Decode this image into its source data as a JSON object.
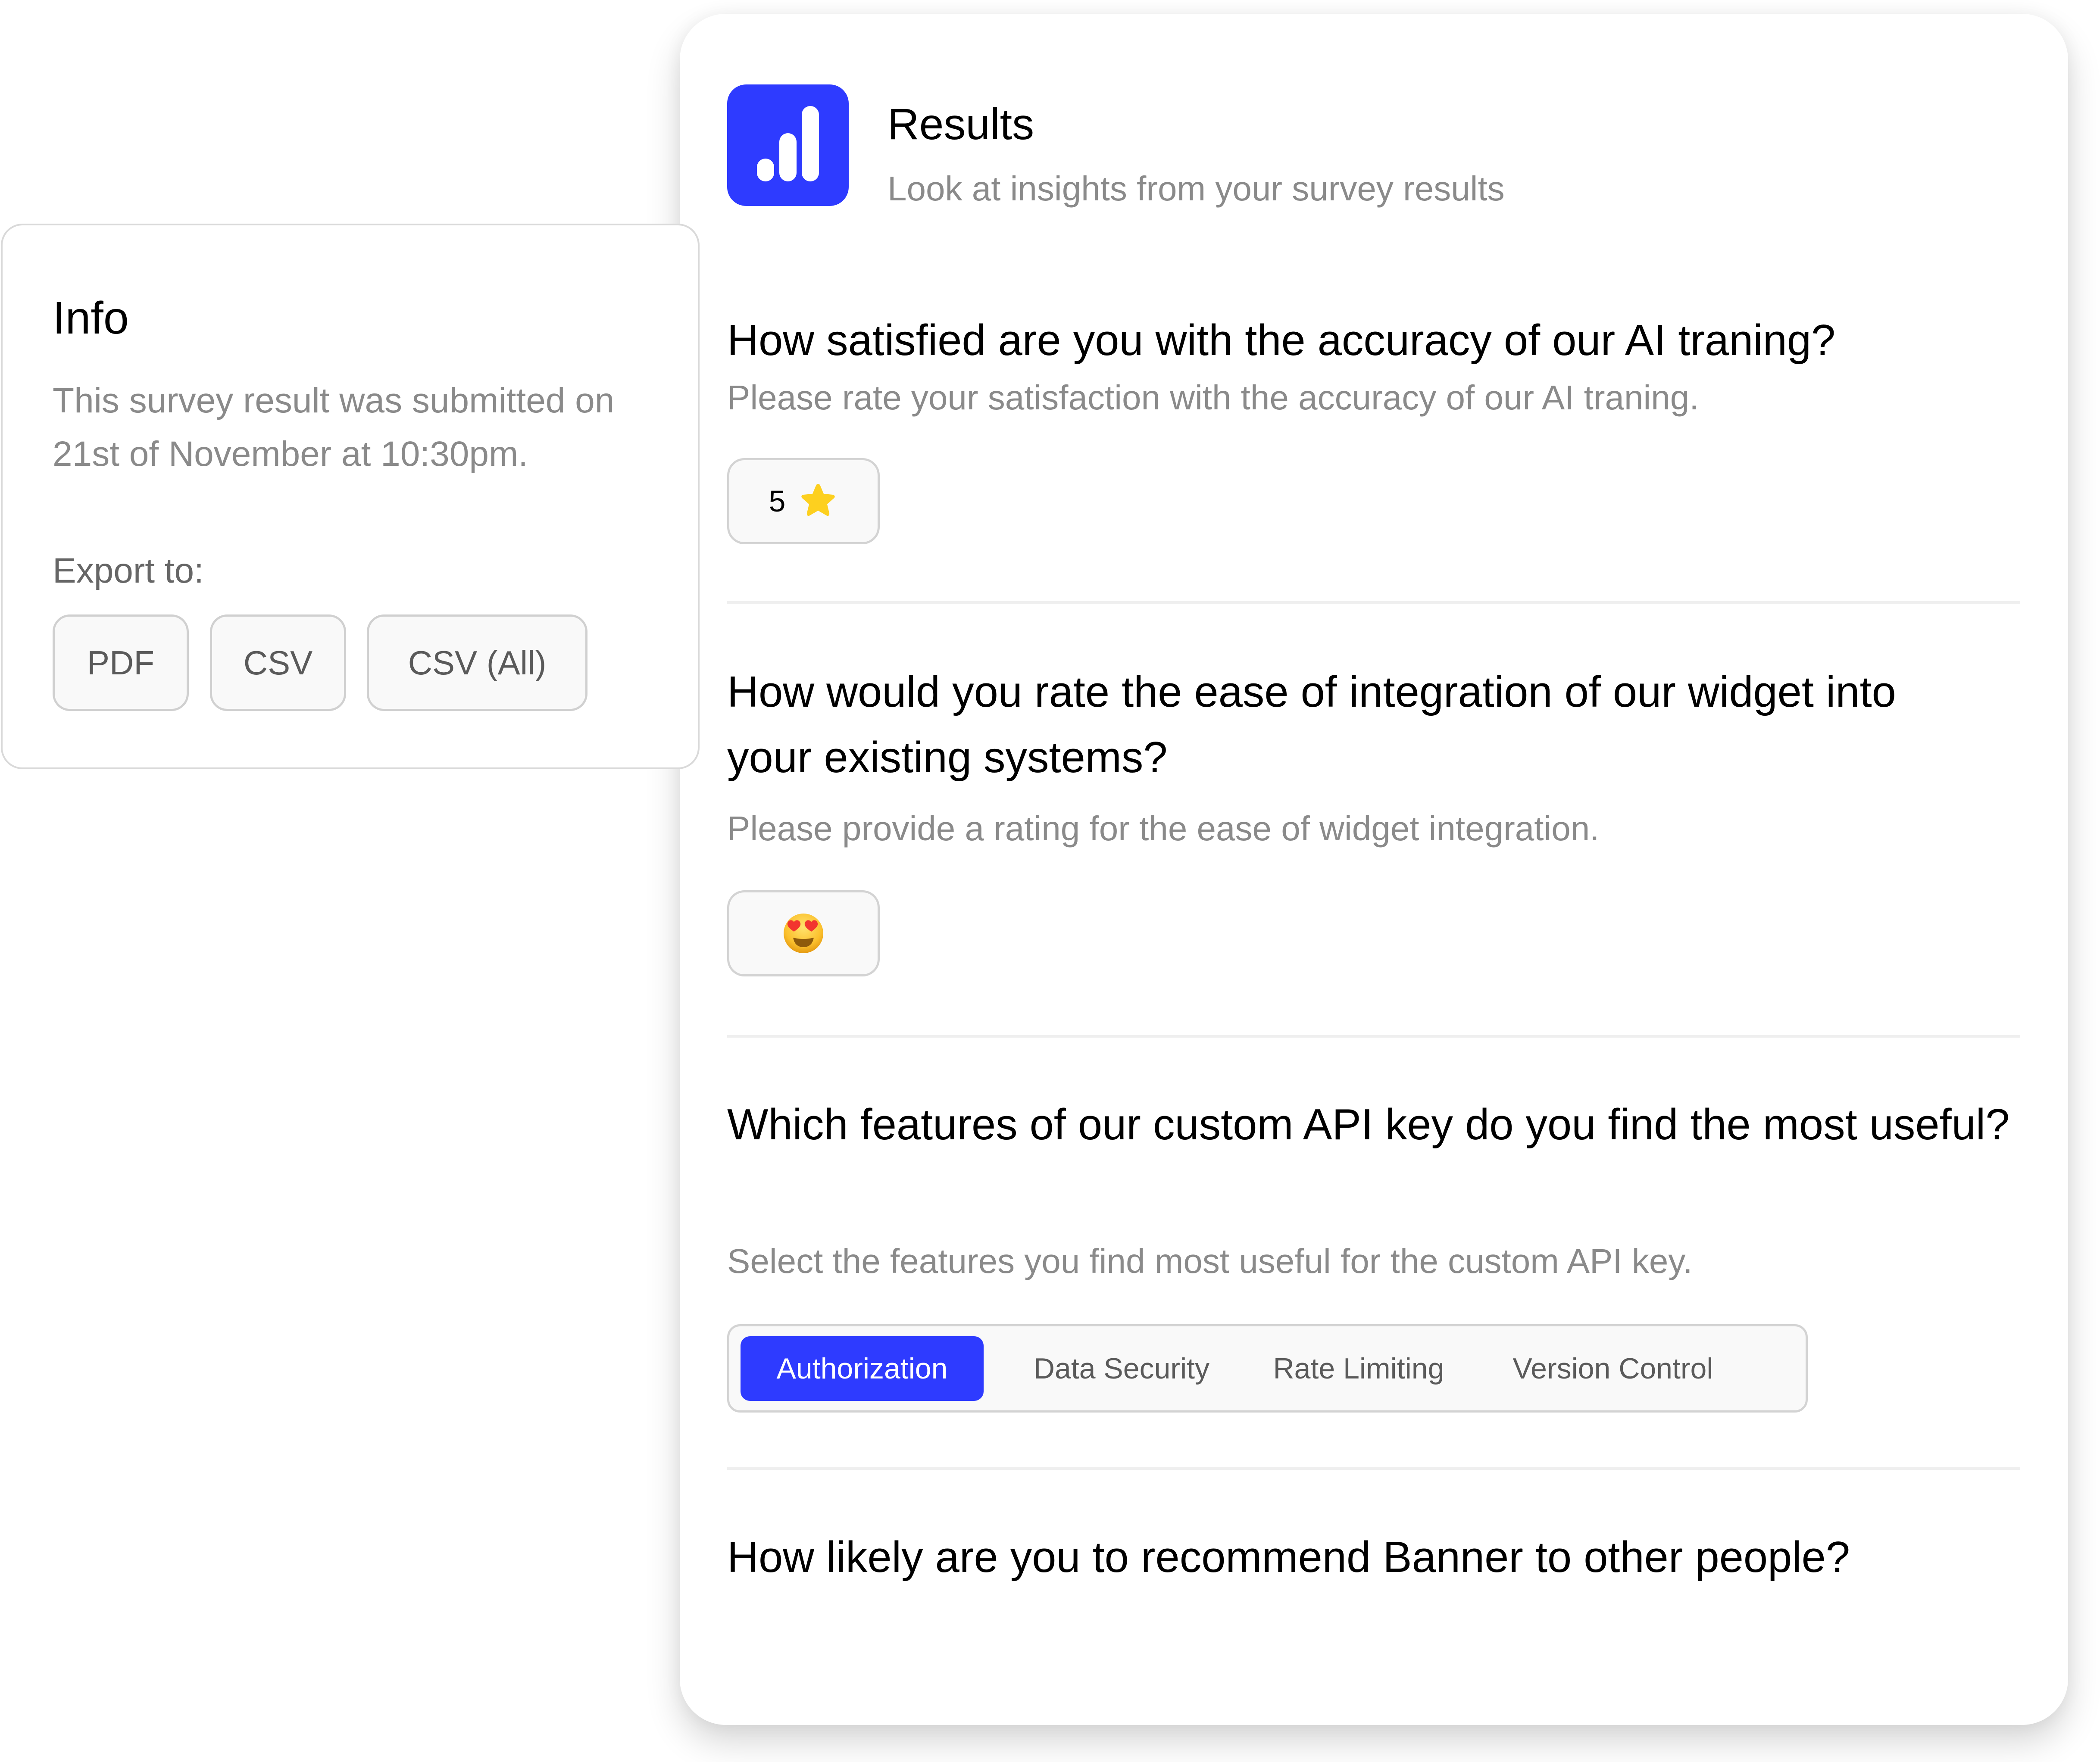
{
  "results": {
    "title": "Results",
    "subtitle": "Look at insights from your survey results",
    "icon": "bar-chart-icon",
    "accent_color": "#2E3BFF"
  },
  "questions": [
    {
      "title": "How satisfied are you with the accuracy of our AI traning?",
      "description": "Please rate your satisfaction with the accuracy of our AI traning.",
      "answer_type": "rating",
      "answer": {
        "value": "5",
        "icon": "star-icon"
      }
    },
    {
      "title": "How would you rate the ease of integration of our widget into your existing systems?",
      "description": "Please provide a rating for the ease of widget integration.",
      "answer_type": "emoji",
      "answer": {
        "icon": "heart-eyes-emoji-icon",
        "glyph": "😍"
      }
    },
    {
      "title": "Which features of our custom API key do you find the most useful?",
      "description": "Select the features you find most useful for the custom API key.",
      "answer_type": "multi-select",
      "options": [
        {
          "label": "Authorization",
          "selected": true
        },
        {
          "label": "Data Security",
          "selected": false
        },
        {
          "label": "Rate Limiting",
          "selected": false
        },
        {
          "label": "Version Control",
          "selected": false
        }
      ]
    },
    {
      "title": "How likely are you to recommend Banner to other people?"
    }
  ],
  "info": {
    "title": "Info",
    "body": "This survey result was submitted on 21st of November at 10:30pm.",
    "export_label": "Export to:",
    "export_buttons": [
      {
        "label": "PDF"
      },
      {
        "label": "CSV"
      },
      {
        "label": "CSV (All)"
      }
    ]
  }
}
